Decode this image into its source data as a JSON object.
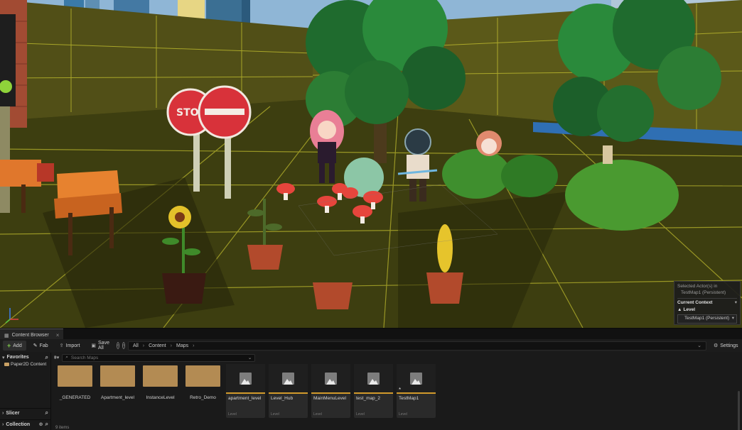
{
  "context_panel": {
    "selected_line1": "Selected Actor(s) in",
    "selected_line2": "TestMap1 (Persistent)",
    "heading": "Current Context",
    "level_label": "Level",
    "level_value": "TestMap1 (Persistent)"
  },
  "content_browser": {
    "tab_label": "Content Browser",
    "toolbar": {
      "add_label": "Add",
      "fab_label": "Fab",
      "import_label": "Import",
      "save_all_label": "Save All",
      "settings_label": "Settings"
    },
    "breadcrumb": [
      "All",
      "Content",
      "Maps"
    ],
    "search_placeholder": "Search Maps",
    "sidebar": {
      "favorites_label": "Favorites",
      "favorites_items": [
        "Paper2D Content"
      ],
      "slicer_label": "Slicer",
      "collection_label": "Collection"
    },
    "folders": [
      "_GENERATED",
      "Apartment_level",
      "InstanceLevel",
      "Retro_Demo"
    ],
    "assets": [
      {
        "name": "apartment_level",
        "type": "Level",
        "dirty": ""
      },
      {
        "name": "Level_Hub",
        "type": "Level",
        "dirty": ""
      },
      {
        "name": "MainMenuLevel",
        "type": "Level",
        "dirty": ""
      },
      {
        "name": "test_map_2",
        "type": "Level",
        "dirty": ""
      },
      {
        "name": "TestMap1",
        "type": "Level",
        "dirty": "*"
      }
    ],
    "item_count": "9 items"
  },
  "colors": {
    "ground": "#3d3e10",
    "grid": "#c6c330",
    "folder": "#b38b53",
    "level_accent": "#d19a2c",
    "add_green": "#7ec84b"
  }
}
